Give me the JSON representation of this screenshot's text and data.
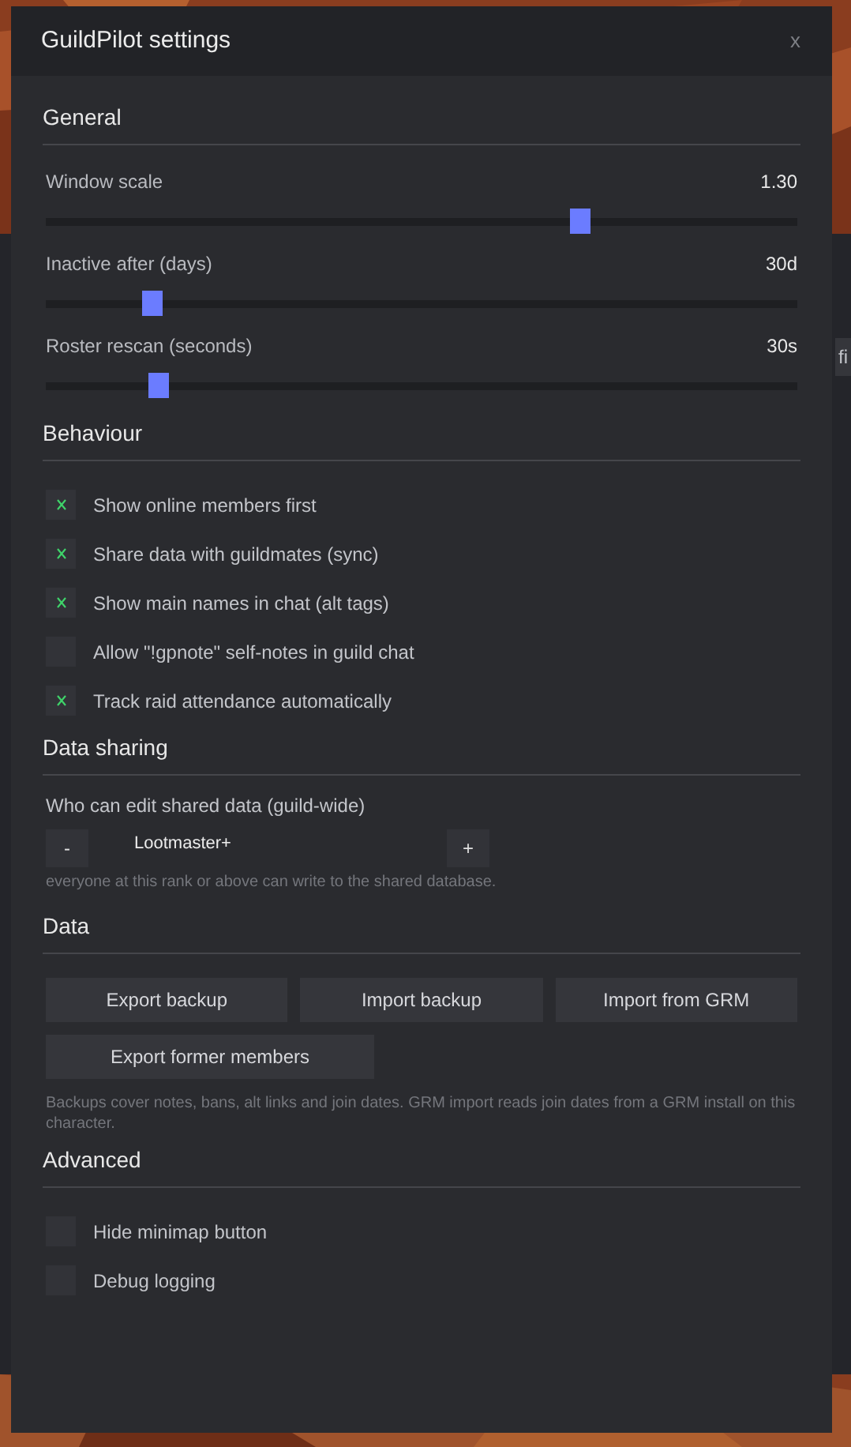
{
  "background_app": {
    "button_fragment": "fi"
  },
  "window": {
    "title": "GuildPilot settings",
    "close": "x"
  },
  "sections": [
    {
      "kind": "sliders",
      "title": "General",
      "items": [
        {
          "label": "Window scale",
          "reading": "1.30",
          "level": 0.71
        },
        {
          "label": "Inactive after (days)",
          "reading": "30d",
          "level": 0.14
        },
        {
          "label": "Roster rescan (seconds)",
          "reading": "30s",
          "level": 0.15
        }
      ]
    },
    {
      "kind": "checks",
      "title": "Behaviour",
      "items": [
        {
          "label": "Show online members first",
          "checked": true
        },
        {
          "label": "Share data with guildmates (sync)",
          "checked": true
        },
        {
          "label": "Show main names in chat (alt tags)",
          "checked": true
        },
        {
          "label": "Allow \"!gpnote\" self-notes in guild chat",
          "checked": false
        },
        {
          "label": "Track raid attendance automatically",
          "checked": true
        }
      ]
    },
    {
      "kind": "stepper",
      "title": "Data sharing",
      "label": "Who can edit shared data (guild-wide)",
      "minus": "-",
      "value": "Lootmaster+",
      "plus": "+",
      "note": "everyone at this rank or above can write to the shared database."
    },
    {
      "kind": "buttons",
      "title": "Data",
      "buttons": [
        "Export backup",
        "Import backup",
        "Import from GRM",
        "Export former members"
      ],
      "note": "Backups cover notes, bans, alt links and join dates. GRM import reads join dates from a GRM install on this character."
    },
    {
      "kind": "checks",
      "title": "Advanced",
      "items": [
        {
          "label": "Hide minimap button",
          "checked": false
        },
        {
          "label": "Debug logging",
          "checked": false
        }
      ]
    }
  ]
}
